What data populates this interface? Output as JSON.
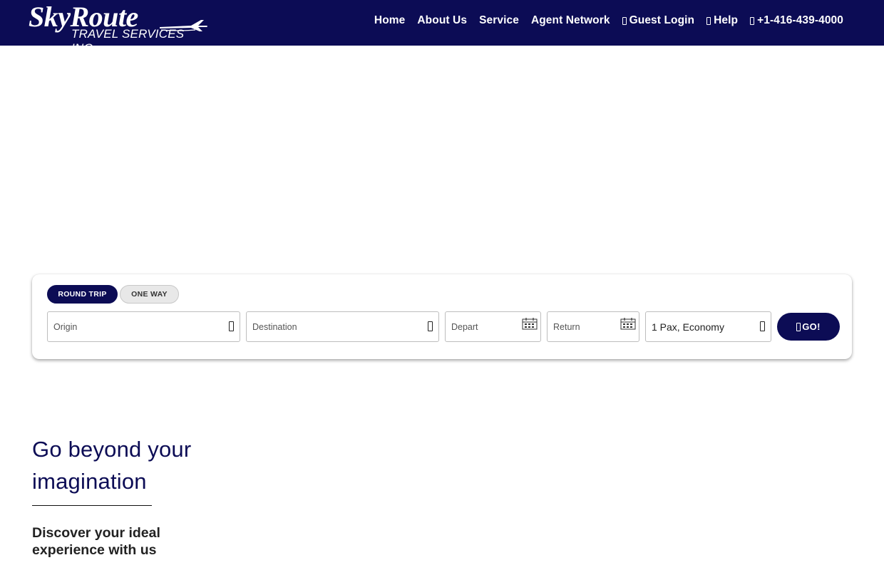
{
  "brand": {
    "name": "SkyRoute",
    "tagline": "TRAVEL SERVICES INC."
  },
  "nav": {
    "items": [
      {
        "label": "Home",
        "icon": null
      },
      {
        "label": "About Us",
        "icon": null
      },
      {
        "label": "Service",
        "icon": null
      },
      {
        "label": "Agent Network",
        "icon": null
      },
      {
        "label": "Guest Login",
        "icon": "user-icon"
      },
      {
        "label": "Help",
        "icon": "help-icon"
      },
      {
        "label": "+1-416-439-4000",
        "icon": "phone-icon"
      }
    ]
  },
  "search": {
    "trip_types": {
      "round_trip": "ROUND TRIP",
      "one_way": "ONE WAY",
      "selected": "ROUND TRIP"
    },
    "origin_label": "Origin",
    "destination_label": "Destination",
    "depart_label": "Depart",
    "return_label": "Return",
    "passengers_value": "1 Pax, Economy",
    "go_label": "GO!"
  },
  "content": {
    "headline": "Go beyond your imagination",
    "subhead": "Discover your ideal experience with us"
  },
  "colors": {
    "brand_navy": "#0c0c55",
    "inactive_pill": "#e8e8e8"
  }
}
